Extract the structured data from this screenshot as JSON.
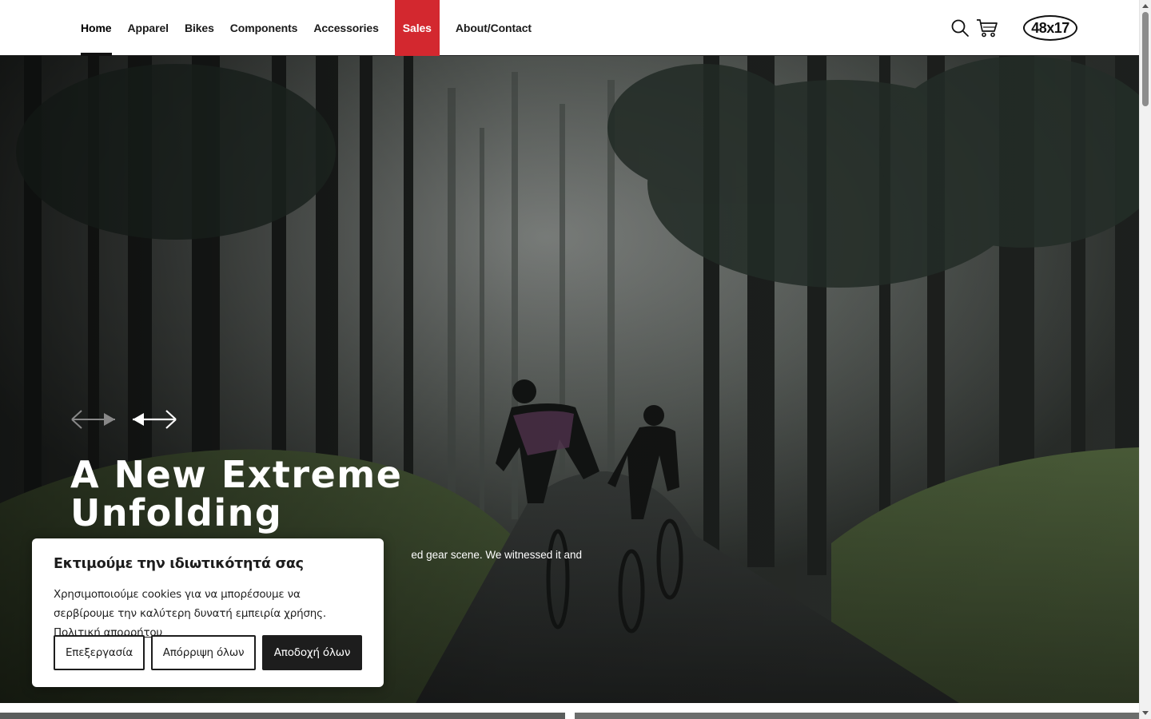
{
  "header": {
    "nav": [
      {
        "label": "Home",
        "active": true
      },
      {
        "label": "Apparel"
      },
      {
        "label": "Bikes"
      },
      {
        "label": "Components"
      },
      {
        "label": "Accessories"
      },
      {
        "label": "Sales",
        "highlight": "#d3282f"
      },
      {
        "label": "About/Contact"
      }
    ],
    "icons": [
      "search-icon",
      "cart-icon"
    ],
    "logo_text": "48x17"
  },
  "hero": {
    "title_line1": "A New Extreme",
    "title_line2": "Unfolding",
    "text": "ed gear scene. We witnessed it and",
    "arrows": [
      "arrow-left-icon",
      "arrow-right-icon"
    ]
  },
  "cookie": {
    "title": "Εκτιμούμε την ιδιωτικότητά σας",
    "text": "Χρησιμοποιούμε cookies για να μπορέσουμε να σερβίρουμε την καλύτερη δυνατή εμπειρία χρήσης.",
    "link": "Πολιτική απορρήτου",
    "buttons": {
      "edit": "Επεξεργασία",
      "reject": "Απόρριψη όλων",
      "accept": "Αποδοχή όλων"
    }
  },
  "colors": {
    "sales": "#d3282f",
    "dark": "#1d1d1d"
  }
}
